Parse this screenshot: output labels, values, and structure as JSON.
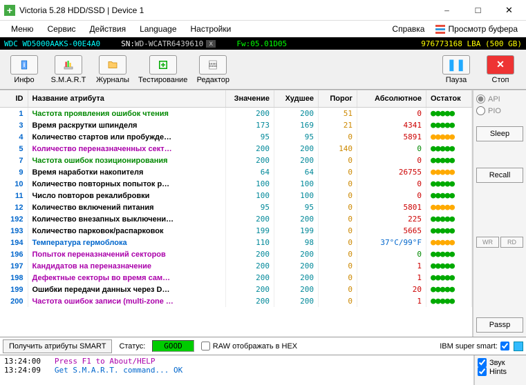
{
  "window": {
    "title": "Victoria 5.28 HDD/SSD | Device 1"
  },
  "menu": [
    "Меню",
    "Сервис",
    "Действия",
    "Language",
    "Настройки",
    "Справка"
  ],
  "viewbuf": "Просмотр буфера",
  "device": {
    "model": "WDC WD5000AAKS-00E4A0",
    "sn_label": "SN: ",
    "sn": "WD-WCATR6439610",
    "fw_label": "Fw: ",
    "fw": "05.01D05",
    "lba": "976773168 LBA (500 GB)"
  },
  "toolbar": [
    "Инфо",
    "S.M.A.R.T",
    "Журналы",
    "Тестирование",
    "Редактор"
  ],
  "toolbar_right": {
    "pause": "Пауза",
    "stop": "Стоп"
  },
  "columns": [
    "ID",
    "Название атрибута",
    "Значение",
    "Худшее",
    "Порог",
    "Абсолютное",
    "Остаток"
  ],
  "rows": [
    {
      "id": 1,
      "name": "Частота проявления ошибок чтения",
      "nc": "green",
      "val": 200,
      "worst": 200,
      "thr": 51,
      "abs": "0",
      "absc": "red",
      "dots": "green"
    },
    {
      "id": 3,
      "name": "Время раскрутки шпинделя",
      "nc": "black",
      "val": 173,
      "worst": 169,
      "thr": 21,
      "abs": "4341",
      "absc": "red",
      "dots": "green"
    },
    {
      "id": 4,
      "name": "Количество стартов или пробужде…",
      "nc": "black",
      "val": 95,
      "worst": 95,
      "thr": 0,
      "abs": "5891",
      "absc": "red",
      "dots": "yellow"
    },
    {
      "id": 5,
      "name": "Количество переназначенных сект…",
      "nc": "purple",
      "val": 200,
      "worst": 200,
      "thr": 140,
      "abs": "0",
      "absc": "green",
      "dots": "green"
    },
    {
      "id": 7,
      "name": "Частота ошибок позиционирования",
      "nc": "green",
      "val": 200,
      "worst": 200,
      "thr": 0,
      "abs": "0",
      "absc": "red",
      "dots": "green"
    },
    {
      "id": 9,
      "name": "Время наработки накопителя",
      "nc": "black",
      "val": 64,
      "worst": 64,
      "thr": 0,
      "abs": "26755",
      "absc": "red",
      "dots": "yellow"
    },
    {
      "id": 10,
      "name": "Количество повторных попыток р…",
      "nc": "black",
      "val": 100,
      "worst": 100,
      "thr": 0,
      "abs": "0",
      "absc": "red",
      "dots": "green"
    },
    {
      "id": 11,
      "name": "Число повторов рекалибровки",
      "nc": "black",
      "val": 100,
      "worst": 100,
      "thr": 0,
      "abs": "0",
      "absc": "red",
      "dots": "green"
    },
    {
      "id": 12,
      "name": "Количество включений питания",
      "nc": "black",
      "val": 95,
      "worst": 95,
      "thr": 0,
      "abs": "5801",
      "absc": "red",
      "dots": "yellow"
    },
    {
      "id": 192,
      "name": "Количество внезапных выключени…",
      "nc": "black",
      "val": 200,
      "worst": 200,
      "thr": 0,
      "abs": "225",
      "absc": "red",
      "dots": "green"
    },
    {
      "id": 193,
      "name": "Количество парковок/распарковок",
      "nc": "black",
      "val": 199,
      "worst": 199,
      "thr": 0,
      "abs": "5665",
      "absc": "red",
      "dots": "green"
    },
    {
      "id": 194,
      "name": "Температура гермоблока",
      "nc": "blue",
      "val": 110,
      "worst": 98,
      "thr": 0,
      "abs": "37°C/99°F",
      "absc": "blue",
      "dots": "yellow"
    },
    {
      "id": 196,
      "name": "Попыток переназначений секторов",
      "nc": "purple",
      "val": 200,
      "worst": 200,
      "thr": 0,
      "abs": "0",
      "absc": "green",
      "dots": "green"
    },
    {
      "id": 197,
      "name": "Кандидатов на переназначение",
      "nc": "purple",
      "val": 200,
      "worst": 200,
      "thr": 0,
      "abs": "1",
      "absc": "red",
      "dots": "green"
    },
    {
      "id": 198,
      "name": "Дефектные секторы во время сам…",
      "nc": "purple",
      "val": 200,
      "worst": 200,
      "thr": 0,
      "abs": "1",
      "absc": "red",
      "dots": "green"
    },
    {
      "id": 199,
      "name": "Ошибки передачи данных через D…",
      "nc": "black",
      "val": 200,
      "worst": 200,
      "thr": 0,
      "abs": "20",
      "absc": "red",
      "dots": "green"
    },
    {
      "id": 200,
      "name": "Частота ошибок записи (multi-zone …",
      "nc": "purple",
      "val": 200,
      "worst": 200,
      "thr": 0,
      "abs": "1",
      "absc": "red",
      "dots": "green"
    }
  ],
  "side": {
    "api": "API",
    "pio": "PIO",
    "sleep": "Sleep",
    "recall": "Recall",
    "wr": "WR",
    "rd": "RD",
    "passp": "Passp"
  },
  "status": {
    "get": "Получить атрибуты SMART",
    "status_lbl": "Статус:",
    "status_val": "GOOD",
    "raw": "RAW отображать в HEX",
    "ibm": "IBM super smart:"
  },
  "log": [
    {
      "t": "13:24:00",
      "m": "Press F1 to About/HELP",
      "c": "logmsg1"
    },
    {
      "t": "13:24:09",
      "m": "Get S.M.A.R.T. command... OK",
      "c": "logmsg2"
    }
  ],
  "logside": {
    "sound": "Звук",
    "hints": "Hints"
  }
}
